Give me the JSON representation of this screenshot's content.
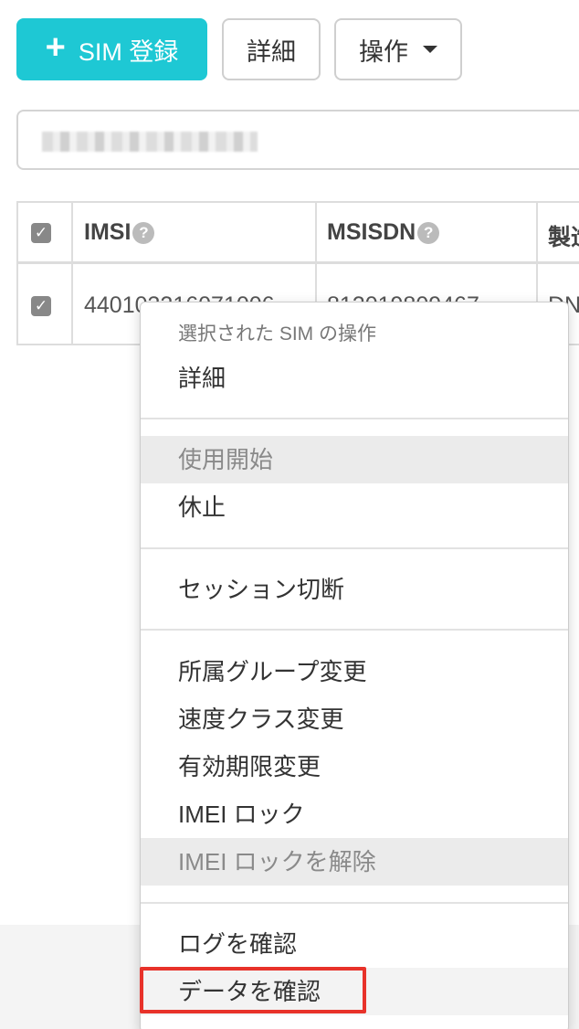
{
  "theme": {
    "accent": "#1ec8d4",
    "highlight": "#e8322a"
  },
  "toolbar": {
    "register_icon": "plus-icon",
    "register_label": "SIM 登録",
    "detail_label": "詳細",
    "operations_label": "操作"
  },
  "search": {
    "value": ""
  },
  "table": {
    "headers": {
      "imsi": "IMSI",
      "msisdn": "MSISDN",
      "maker": "製造"
    },
    "rows": [
      {
        "imsi": "440103216071006",
        "msisdn": "812019809467",
        "maker": "DN"
      }
    ]
  },
  "menu": {
    "header": "選択された SIM の操作",
    "items": [
      {
        "label": "詳細",
        "disabled": false
      },
      {
        "label": "使用開始",
        "disabled": true
      },
      {
        "label": "休止",
        "disabled": false
      },
      {
        "label": "セッション切断",
        "disabled": false
      },
      {
        "label": "所属グループ変更",
        "disabled": false
      },
      {
        "label": "速度クラス変更",
        "disabled": false
      },
      {
        "label": "有効期限変更",
        "disabled": false
      },
      {
        "label": "IMEI ロック",
        "disabled": false
      },
      {
        "label": "IMEI ロックを解除",
        "disabled": true
      },
      {
        "label": "ログを確認",
        "disabled": false
      },
      {
        "label": "データを確認",
        "disabled": false
      }
    ]
  }
}
